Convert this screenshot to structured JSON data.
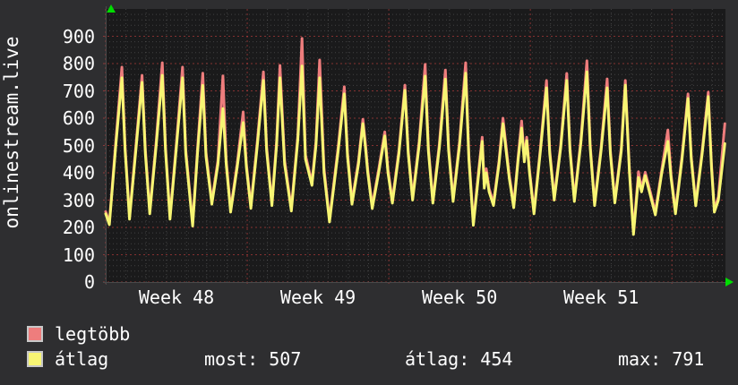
{
  "app": {
    "background": "#2e2e30",
    "text_color": "#ffffff"
  },
  "y_axis_title": "onlinestream.live",
  "legend": [
    {
      "label": "legtöbb",
      "color": "#ee7d7d"
    },
    {
      "label": "átlag",
      "color": "#f7f573"
    }
  ],
  "stats": [
    {
      "label": "most",
      "value": 507,
      "text": "most: 507"
    },
    {
      "label": "átlag",
      "value": 454,
      "text": "átlag: 454"
    },
    {
      "label": "max",
      "value": 791,
      "text": "max: 791"
    }
  ],
  "chart_data": {
    "type": "line",
    "title": "",
    "ylabel_rotated": "onlinestream.live",
    "xlabel": "",
    "y_ticks": [
      0,
      100,
      200,
      300,
      400,
      500,
      600,
      700,
      800,
      900
    ],
    "y_top_value": 1000,
    "grid_minor_step": 20,
    "grid_major_step": 100,
    "days_total": 30.65,
    "week_boundaries_days": [
      0,
      7,
      14,
      21,
      28
    ],
    "x_week_labels": [
      {
        "label": "Week 48",
        "center_day": 3.5
      },
      {
        "label": "Week 49",
        "center_day": 10.5
      },
      {
        "label": "Week 50",
        "center_day": 17.5
      },
      {
        "label": "Week 51",
        "center_day": 24.5
      }
    ],
    "colors": {
      "plot_background": "#1a1a1b",
      "grid_minor": "rgba(150,150,150,0.32)",
      "grid_major": "rgba(205,65,65,0.60)",
      "axis": "#4a4a4a",
      "arrow": "#00dd00"
    },
    "legend_position": "bottom-left",
    "series": [
      {
        "name": "legtöbb",
        "color": "#ee7d7d",
        "width": 3,
        "points": [
          [
            0.0,
            258
          ],
          [
            0.18,
            218
          ],
          [
            0.5,
            515
          ],
          [
            0.8,
            787
          ],
          [
            0.96,
            495
          ],
          [
            1.18,
            240
          ],
          [
            1.5,
            505
          ],
          [
            1.8,
            757
          ],
          [
            1.96,
            485
          ],
          [
            2.18,
            260
          ],
          [
            2.5,
            515
          ],
          [
            2.8,
            803
          ],
          [
            2.96,
            495
          ],
          [
            3.18,
            240
          ],
          [
            3.5,
            510
          ],
          [
            3.8,
            787
          ],
          [
            3.96,
            485
          ],
          [
            4.3,
            215
          ],
          [
            4.55,
            495
          ],
          [
            4.8,
            765
          ],
          [
            4.96,
            475
          ],
          [
            5.25,
            295
          ],
          [
            5.55,
            445
          ],
          [
            5.8,
            755
          ],
          [
            5.96,
            445
          ],
          [
            6.18,
            266
          ],
          [
            6.5,
            432
          ],
          [
            6.8,
            623
          ],
          [
            6.96,
            432
          ],
          [
            7.18,
            280
          ],
          [
            7.5,
            515
          ],
          [
            7.8,
            770
          ],
          [
            7.96,
            495
          ],
          [
            8.22,
            290
          ],
          [
            8.45,
            515
          ],
          [
            8.62,
            793
          ],
          [
            8.85,
            445
          ],
          [
            9.18,
            270
          ],
          [
            9.5,
            535
          ],
          [
            9.71,
            892
          ],
          [
            9.88,
            465
          ],
          [
            10.2,
            364
          ],
          [
            10.4,
            515
          ],
          [
            10.58,
            813
          ],
          [
            10.8,
            415
          ],
          [
            11.07,
            230
          ],
          [
            11.5,
            495
          ],
          [
            11.8,
            715
          ],
          [
            11.96,
            475
          ],
          [
            12.18,
            295
          ],
          [
            12.5,
            442
          ],
          [
            12.72,
            596
          ],
          [
            12.85,
            505
          ],
          [
            12.96,
            412
          ],
          [
            13.18,
            279
          ],
          [
            13.5,
            412
          ],
          [
            13.8,
            550
          ],
          [
            13.96,
            412
          ],
          [
            14.18,
            299
          ],
          [
            14.5,
            482
          ],
          [
            14.8,
            721
          ],
          [
            14.96,
            482
          ],
          [
            15.18,
            310
          ],
          [
            15.5,
            515
          ],
          [
            15.8,
            797
          ],
          [
            15.96,
            495
          ],
          [
            16.18,
            299
          ],
          [
            16.5,
            505
          ],
          [
            16.8,
            776
          ],
          [
            16.96,
            495
          ],
          [
            17.18,
            305
          ],
          [
            17.5,
            515
          ],
          [
            17.8,
            803
          ],
          [
            17.96,
            465
          ],
          [
            18.18,
            218
          ],
          [
            18.45,
            415
          ],
          [
            18.62,
            530
          ],
          [
            18.72,
            356
          ],
          [
            18.82,
            415
          ],
          [
            18.96,
            342
          ],
          [
            19.18,
            290
          ],
          [
            19.45,
            442
          ],
          [
            19.65,
            600
          ],
          [
            19.96,
            392
          ],
          [
            20.18,
            282
          ],
          [
            20.4,
            462
          ],
          [
            20.57,
            590
          ],
          [
            20.7,
            452
          ],
          [
            20.82,
            530
          ],
          [
            20.96,
            412
          ],
          [
            21.18,
            260
          ],
          [
            21.5,
            492
          ],
          [
            21.8,
            738
          ],
          [
            21.96,
            482
          ],
          [
            22.18,
            310
          ],
          [
            22.5,
            502
          ],
          [
            22.8,
            764
          ],
          [
            22.96,
            492
          ],
          [
            23.18,
            305
          ],
          [
            23.5,
            522
          ],
          [
            23.8,
            810
          ],
          [
            23.96,
            502
          ],
          [
            24.18,
            290
          ],
          [
            24.5,
            492
          ],
          [
            24.8,
            744
          ],
          [
            24.96,
            482
          ],
          [
            25.18,
            300
          ],
          [
            25.5,
            492
          ],
          [
            25.7,
            738
          ],
          [
            25.9,
            412
          ],
          [
            26.1,
            184
          ],
          [
            26.35,
            404
          ],
          [
            26.5,
            342
          ],
          [
            26.68,
            402
          ],
          [
            26.96,
            322
          ],
          [
            27.18,
            256
          ],
          [
            27.5,
            412
          ],
          [
            27.8,
            557
          ],
          [
            27.96,
            392
          ],
          [
            28.18,
            260
          ],
          [
            28.5,
            462
          ],
          [
            28.8,
            689
          ],
          [
            28.96,
            462
          ],
          [
            29.18,
            289
          ],
          [
            29.5,
            482
          ],
          [
            29.8,
            695
          ],
          [
            29.96,
            432
          ],
          [
            30.1,
            266
          ],
          [
            30.3,
            312
          ],
          [
            30.62,
            580
          ]
        ]
      },
      {
        "name": "átlag",
        "color": "#f7f573",
        "width": 3,
        "points": [
          [
            0.0,
            250
          ],
          [
            0.18,
            210
          ],
          [
            0.5,
            500
          ],
          [
            0.8,
            748
          ],
          [
            0.96,
            480
          ],
          [
            1.18,
            230
          ],
          [
            1.5,
            490
          ],
          [
            1.8,
            731
          ],
          [
            1.96,
            470
          ],
          [
            2.18,
            250
          ],
          [
            2.5,
            500
          ],
          [
            2.8,
            757
          ],
          [
            2.96,
            480
          ],
          [
            3.18,
            230
          ],
          [
            3.5,
            495
          ],
          [
            3.8,
            748
          ],
          [
            3.96,
            470
          ],
          [
            4.3,
            205
          ],
          [
            4.55,
            480
          ],
          [
            4.8,
            720
          ],
          [
            4.96,
            460
          ],
          [
            5.25,
            285
          ],
          [
            5.55,
            430
          ],
          [
            5.8,
            635
          ],
          [
            5.96,
            430
          ],
          [
            6.18,
            256
          ],
          [
            6.5,
            420
          ],
          [
            6.8,
            584
          ],
          [
            6.96,
            420
          ],
          [
            7.18,
            270
          ],
          [
            7.5,
            500
          ],
          [
            7.8,
            738
          ],
          [
            7.96,
            480
          ],
          [
            8.22,
            280
          ],
          [
            8.45,
            500
          ],
          [
            8.62,
            748
          ],
          [
            8.85,
            430
          ],
          [
            9.18,
            260
          ],
          [
            9.5,
            520
          ],
          [
            9.71,
            791
          ],
          [
            9.88,
            450
          ],
          [
            10.2,
            354
          ],
          [
            10.4,
            500
          ],
          [
            10.58,
            748
          ],
          [
            10.8,
            400
          ],
          [
            11.07,
            220
          ],
          [
            11.5,
            480
          ],
          [
            11.8,
            689
          ],
          [
            11.96,
            460
          ],
          [
            12.18,
            285
          ],
          [
            12.5,
            430
          ],
          [
            12.72,
            580
          ],
          [
            12.85,
            490
          ],
          [
            12.96,
            400
          ],
          [
            13.18,
            269
          ],
          [
            13.5,
            400
          ],
          [
            13.8,
            535
          ],
          [
            13.96,
            400
          ],
          [
            14.18,
            289
          ],
          [
            14.5,
            470
          ],
          [
            14.8,
            702
          ],
          [
            14.96,
            470
          ],
          [
            15.18,
            300
          ],
          [
            15.5,
            500
          ],
          [
            15.8,
            754
          ],
          [
            15.96,
            480
          ],
          [
            16.18,
            289
          ],
          [
            16.5,
            490
          ],
          [
            16.8,
            743
          ],
          [
            16.96,
            480
          ],
          [
            17.18,
            295
          ],
          [
            17.5,
            500
          ],
          [
            17.8,
            765
          ],
          [
            17.96,
            450
          ],
          [
            18.18,
            208
          ],
          [
            18.45,
            400
          ],
          [
            18.62,
            515
          ],
          [
            18.72,
            344
          ],
          [
            18.82,
            400
          ],
          [
            18.96,
            330
          ],
          [
            19.18,
            280
          ],
          [
            19.45,
            430
          ],
          [
            19.65,
            580
          ],
          [
            19.96,
            380
          ],
          [
            20.18,
            272
          ],
          [
            20.4,
            450
          ],
          [
            20.57,
            564
          ],
          [
            20.7,
            440
          ],
          [
            20.82,
            518
          ],
          [
            20.96,
            400
          ],
          [
            21.18,
            250
          ],
          [
            21.5,
            480
          ],
          [
            21.8,
            711
          ],
          [
            21.96,
            470
          ],
          [
            22.18,
            300
          ],
          [
            22.5,
            490
          ],
          [
            22.8,
            738
          ],
          [
            22.96,
            480
          ],
          [
            23.18,
            295
          ],
          [
            23.5,
            510
          ],
          [
            23.8,
            770
          ],
          [
            23.96,
            490
          ],
          [
            24.18,
            280
          ],
          [
            24.5,
            480
          ],
          [
            24.8,
            711
          ],
          [
            24.96,
            470
          ],
          [
            25.18,
            290
          ],
          [
            25.5,
            480
          ],
          [
            25.7,
            721
          ],
          [
            25.9,
            400
          ],
          [
            26.1,
            174
          ],
          [
            26.35,
            383
          ],
          [
            26.5,
            330
          ],
          [
            26.68,
            390
          ],
          [
            26.96,
            310
          ],
          [
            27.18,
            246
          ],
          [
            27.5,
            400
          ],
          [
            27.8,
            515
          ],
          [
            27.96,
            380
          ],
          [
            28.18,
            250
          ],
          [
            28.5,
            450
          ],
          [
            28.8,
            672
          ],
          [
            28.96,
            450
          ],
          [
            29.18,
            279
          ],
          [
            29.5,
            470
          ],
          [
            29.8,
            679
          ],
          [
            29.96,
            420
          ],
          [
            30.1,
            256
          ],
          [
            30.3,
            300
          ],
          [
            30.62,
            507
          ]
        ]
      }
    ]
  }
}
